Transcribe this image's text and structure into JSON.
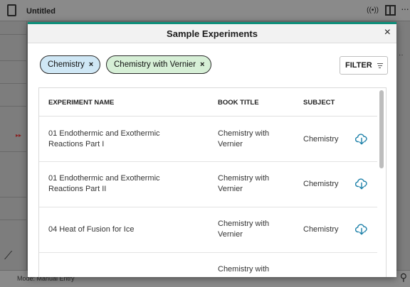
{
  "app": {
    "title": "Untitled",
    "wifi_indicator": "((•))",
    "bottom_label": "Mode: Manual Entry",
    "icons": [
      "document-icon",
      "wireless-icon",
      "panel-icon",
      "more-icon",
      "graph-icon",
      "magnify-icon"
    ]
  },
  "dialog": {
    "title": "Sample Experiments",
    "close_label": "×",
    "chips": [
      {
        "label": "Chemistry",
        "remove": "×",
        "color": "#cfe7f5"
      },
      {
        "label": "Chemistry with Vernier",
        "remove": "×",
        "color": "#d6efd6"
      }
    ],
    "filter_label": "FILTER",
    "accent_color": "#0d8f7a"
  },
  "table": {
    "columns": [
      "EXPERIMENT NAME",
      "BOOK TITLE",
      "SUBJECT"
    ],
    "rows": [
      {
        "name_line1": "01 Endothermic and Exothermic",
        "name_line2": "Reactions Part I",
        "book_line1": "Chemistry with",
        "book_line2": "Vernier",
        "subject": "Chemistry",
        "action": "download-icon"
      },
      {
        "name_line1": "01 Endothermic and Exothermic",
        "name_line2": "Reactions Part II",
        "book_line1": "Chemistry with",
        "book_line2": "Vernier",
        "subject": "Chemistry",
        "action": "download-icon"
      },
      {
        "name_line1": "04 Heat of Fusion for Ice",
        "name_line2": "",
        "book_line1": "Chemistry with",
        "book_line2": "Vernier",
        "subject": "Chemistry",
        "action": "download-icon"
      },
      {
        "name_line1": "",
        "name_line2": "",
        "book_line1": "Chemistry with",
        "book_line2": "",
        "subject": "",
        "action": ""
      }
    ]
  }
}
